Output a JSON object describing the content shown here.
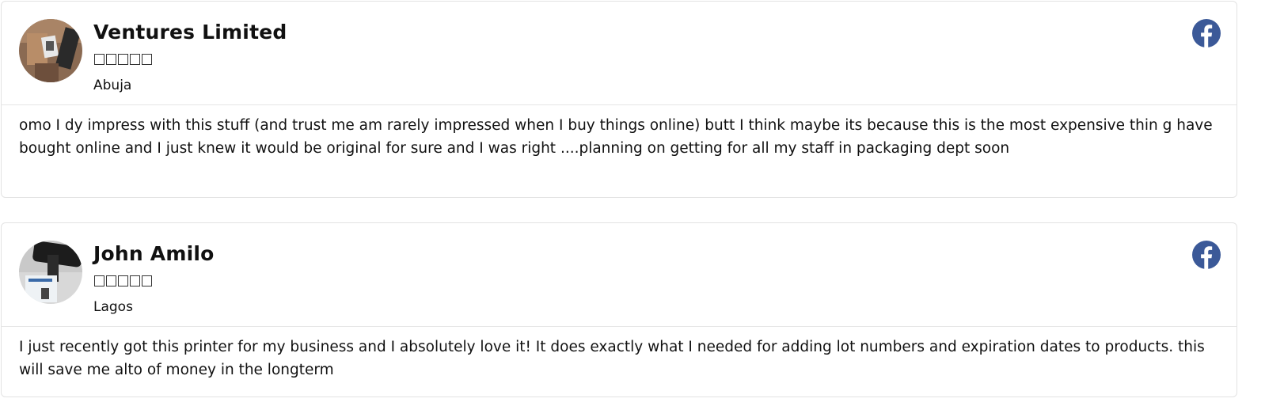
{
  "reviews": [
    {
      "name": "Ventures Limited",
      "rating_stars": "□□□□□",
      "location": "Abuja",
      "text": "omo I dy impress with this stuff (and trust me am rarely impressed when I buy things online) butt I think maybe its because this is the most expensive thin g have bought online and I just knew it would be original for sure and I was right ....planning on getting for all my staff in packaging dept soon",
      "source_icon": "facebook-icon"
    },
    {
      "name": "John Amilo",
      "rating_stars": "□□□□□",
      "location": "Lagos",
      "text": "I just recently got this printer for my business and I absolutely love it! It does exactly what I needed for adding lot numbers and expiration dates to products. this will save me alto of money in the longterm",
      "source_icon": "facebook-icon"
    }
  ],
  "colors": {
    "facebook_blue": "#3b5998",
    "card_border": "#e3e3e3"
  }
}
